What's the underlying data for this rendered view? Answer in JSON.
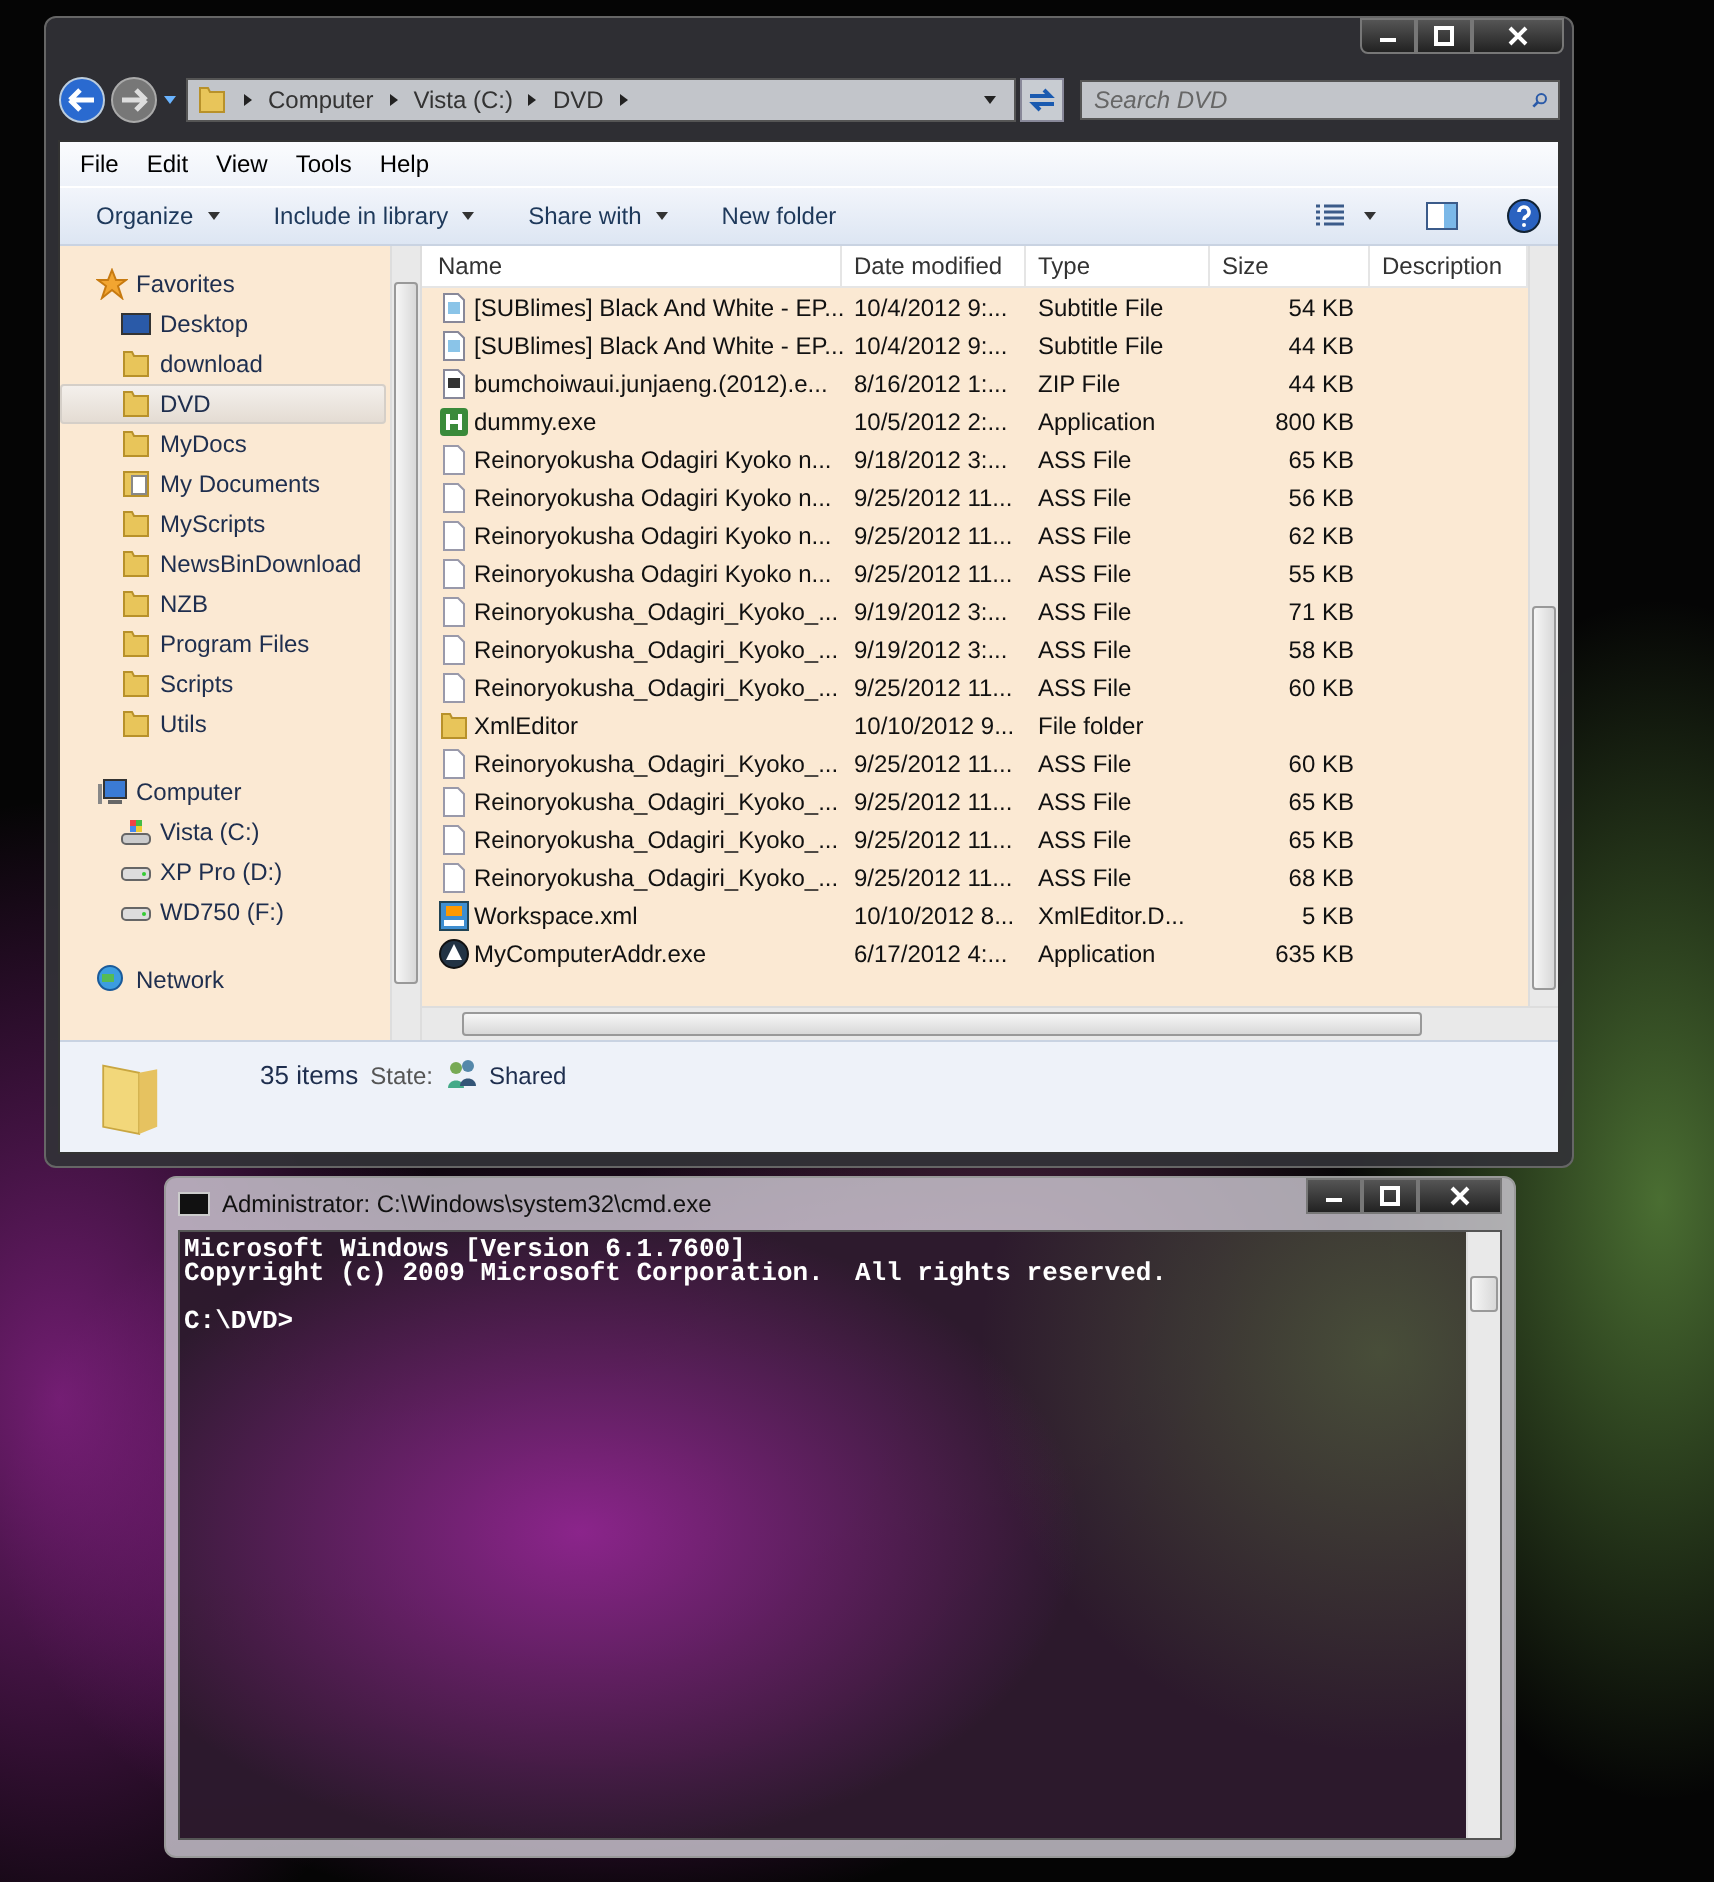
{
  "explorer": {
    "address": {
      "crumbs": [
        "Computer",
        "Vista (C:)",
        "DVD"
      ]
    },
    "search": {
      "placeholder": "Search DVD"
    },
    "menu": [
      "File",
      "Edit",
      "View",
      "Tools",
      "Help"
    ],
    "toolbar": [
      {
        "label": "Organize",
        "dropdown": true
      },
      {
        "label": "Include in library",
        "dropdown": true
      },
      {
        "label": "Share with",
        "dropdown": true
      },
      {
        "label": "New folder",
        "dropdown": false
      }
    ],
    "sidebar": [
      {
        "label": "Favorites",
        "kind": "star",
        "children": [
          {
            "label": "Desktop",
            "kind": "desktop",
            "selected": false
          },
          {
            "label": "download",
            "kind": "folder",
            "selected": false
          },
          {
            "label": "DVD",
            "kind": "folder",
            "selected": true
          },
          {
            "label": "MyDocs",
            "kind": "folder",
            "selected": false
          },
          {
            "label": "My Documents",
            "kind": "docs",
            "selected": false
          },
          {
            "label": "MyScripts",
            "kind": "folder",
            "selected": false
          },
          {
            "label": "NewsBinDownload",
            "kind": "folder",
            "selected": false
          },
          {
            "label": "NZB",
            "kind": "folder",
            "selected": false
          },
          {
            "label": "Program Files",
            "kind": "folder",
            "selected": false
          },
          {
            "label": "Scripts",
            "kind": "folder",
            "selected": false
          },
          {
            "label": "Utils",
            "kind": "folder",
            "selected": false
          }
        ]
      },
      {
        "label": "Computer",
        "kind": "computer",
        "children": [
          {
            "label": "Vista (C:)",
            "kind": "windrive",
            "selected": false
          },
          {
            "label": "XP Pro (D:)",
            "kind": "drive",
            "selected": false
          },
          {
            "label": "WD750 (F:)",
            "kind": "drive",
            "selected": false
          }
        ]
      },
      {
        "label": "Network",
        "kind": "network"
      }
    ],
    "columns": [
      "Name",
      "Date modified",
      "Type",
      "Size",
      "Description"
    ],
    "rows": [
      {
        "kind": "subtitle",
        "name": "[SUBlimes] Black And White - EP...",
        "date": "10/4/2012 9:...",
        "type": "Subtitle File",
        "size": "54 KB"
      },
      {
        "kind": "subtitle",
        "name": "[SUBlimes] Black And White - EP...",
        "date": "10/4/2012 9:...",
        "type": "Subtitle File",
        "size": "44 KB"
      },
      {
        "kind": "zip",
        "name": "bumchoiwaui.junjaeng.(2012).e...",
        "date": "8/16/2012 1:...",
        "type": "ZIP File",
        "size": "44 KB"
      },
      {
        "kind": "app-h",
        "name": "dummy.exe",
        "date": "10/5/2012 2:...",
        "type": "Application",
        "size": "800 KB"
      },
      {
        "kind": "file",
        "name": "Reinoryokusha Odagiri Kyoko n...",
        "date": "9/18/2012 3:...",
        "type": "ASS File",
        "size": "65 KB"
      },
      {
        "kind": "file",
        "name": "Reinoryokusha Odagiri Kyoko n...",
        "date": "9/25/2012 11...",
        "type": "ASS File",
        "size": "56 KB"
      },
      {
        "kind": "file",
        "name": "Reinoryokusha Odagiri Kyoko n...",
        "date": "9/25/2012 11...",
        "type": "ASS File",
        "size": "62 KB"
      },
      {
        "kind": "file",
        "name": "Reinoryokusha Odagiri Kyoko n...",
        "date": "9/25/2012 11...",
        "type": "ASS File",
        "size": "55 KB"
      },
      {
        "kind": "file",
        "name": "Reinoryokusha_Odagiri_Kyoko_...",
        "date": "9/19/2012 3:...",
        "type": "ASS File",
        "size": "71 KB"
      },
      {
        "kind": "file",
        "name": "Reinoryokusha_Odagiri_Kyoko_...",
        "date": "9/19/2012 3:...",
        "type": "ASS File",
        "size": "58 KB"
      },
      {
        "kind": "file",
        "name": "Reinoryokusha_Odagiri_Kyoko_...",
        "date": "9/25/2012 11...",
        "type": "ASS File",
        "size": "60 KB"
      },
      {
        "kind": "folder",
        "name": "XmlEditor",
        "date": "10/10/2012 9...",
        "type": "File folder"
      },
      {
        "kind": "file",
        "name": "Reinoryokusha_Odagiri_Kyoko_...",
        "date": "9/25/2012 11...",
        "type": "ASS File",
        "size": "60 KB"
      },
      {
        "kind": "file",
        "name": "Reinoryokusha_Odagiri_Kyoko_...",
        "date": "9/25/2012 11...",
        "type": "ASS File",
        "size": "65 KB"
      },
      {
        "kind": "file",
        "name": "Reinoryokusha_Odagiri_Kyoko_...",
        "date": "9/25/2012 11...",
        "type": "ASS File",
        "size": "65 KB"
      },
      {
        "kind": "file",
        "name": "Reinoryokusha_Odagiri_Kyoko_...",
        "date": "9/25/2012 11...",
        "type": "ASS File",
        "size": "68 KB"
      },
      {
        "kind": "xml",
        "name": "Workspace.xml",
        "date": "10/10/2012 8...",
        "type": "XmlEditor.D...",
        "size": "5 KB"
      },
      {
        "kind": "app-a",
        "name": "MyComputerAddr.exe",
        "date": "6/17/2012 4:...",
        "type": "Application",
        "size": "635 KB"
      }
    ],
    "status_bar": {
      "count": "35 items",
      "state_label": "State:",
      "state_value": "Shared"
    }
  },
  "console": {
    "title": "Administrator: C:\\Windows\\system32\\cmd.exe",
    "lines": [
      "Microsoft Windows [Version 6.1.7600]",
      "Copyright (c) 2009 Microsoft Corporation.  All rights reserved."
    ],
    "prompt": "C:\\DVD>"
  }
}
